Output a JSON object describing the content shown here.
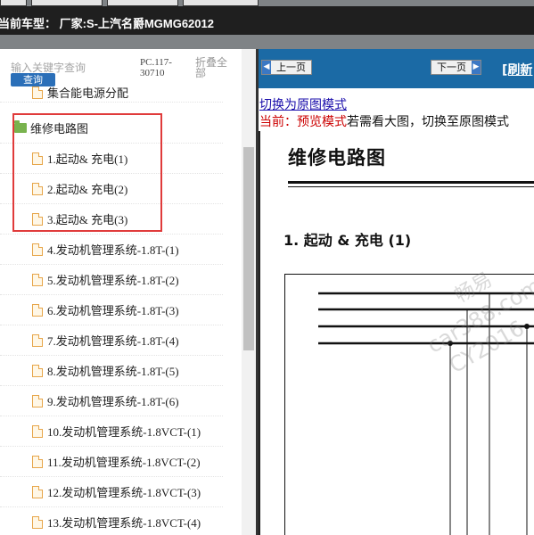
{
  "header": {
    "car_model": "当前车型： 厂家:S-上汽名爵MGMG62012"
  },
  "sidebar": {
    "search_placeholder": "输入关键字查询",
    "query_button": "查询",
    "pc_code": "PC.117-30710",
    "fold_all": "折叠全部",
    "partial_item": "集合能电源分配",
    "folder_label": "维修电路图",
    "items": [
      "1.起动& 充电(1)",
      "2.起动& 充电(2)",
      "3.起动& 充电(3)",
      "4.发动机管理系统-1.8T-(1)",
      "5.发动机管理系统-1.8T-(2)",
      "6.发动机管理系统-1.8T-(3)",
      "7.发动机管理系统-1.8T-(4)",
      "8.发动机管理系统-1.8T-(5)",
      "9.发动机管理系统-1.8T-(6)",
      "10.发动机管理系统-1.8VCT-(1)",
      "11.发动机管理系统-1.8VCT-(2)",
      "12.发动机管理系统-1.8VCT-(3)",
      "13.发动机管理系统-1.8VCT-(4)"
    ]
  },
  "viewer": {
    "prev_page": "上一页",
    "next_page": "下一页",
    "refresh": "[刷新",
    "switch_link": "切换为原图模式",
    "current_prefix": "当前：",
    "current_mode": "预览模式",
    "hint": "若需看大图，切换至原图模式",
    "doc_title": "维修电路图",
    "section_title": "1. 起动 & 充电 (1)"
  },
  "watermark": {
    "line1": "畅易",
    "line2": "car388.com",
    "line3": "CY2016"
  },
  "colors": {
    "nav_blue": "#1b6aa5",
    "highlight_red": "#e03b3b",
    "folder_green": "#79b34e",
    "doc_orange": "#e7a64a"
  }
}
